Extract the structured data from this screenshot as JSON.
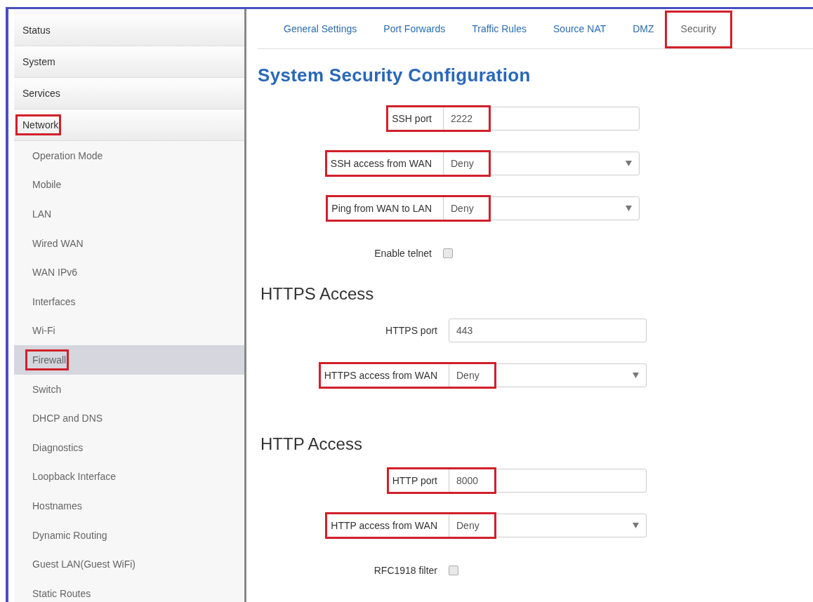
{
  "sidebar": {
    "items": [
      {
        "label": "Status",
        "kind": "group",
        "selected": false,
        "highlighted": false
      },
      {
        "label": "System",
        "kind": "group",
        "selected": false,
        "highlighted": false
      },
      {
        "label": "Services",
        "kind": "group",
        "selected": false,
        "highlighted": false
      },
      {
        "label": "Network",
        "kind": "group",
        "selected": false,
        "highlighted": true
      },
      {
        "label": "Operation Mode",
        "kind": "sub",
        "selected": false,
        "highlighted": false
      },
      {
        "label": "Mobile",
        "kind": "sub",
        "selected": false,
        "highlighted": false
      },
      {
        "label": "LAN",
        "kind": "sub",
        "selected": false,
        "highlighted": false
      },
      {
        "label": "Wired WAN",
        "kind": "sub",
        "selected": false,
        "highlighted": false
      },
      {
        "label": "WAN IPv6",
        "kind": "sub",
        "selected": false,
        "highlighted": false
      },
      {
        "label": "Interfaces",
        "kind": "sub",
        "selected": false,
        "highlighted": false
      },
      {
        "label": "Wi-Fi",
        "kind": "sub",
        "selected": false,
        "highlighted": false
      },
      {
        "label": "Firewall",
        "kind": "sub",
        "selected": true,
        "highlighted": true
      },
      {
        "label": "Switch",
        "kind": "sub",
        "selected": false,
        "highlighted": false
      },
      {
        "label": "DHCP and DNS",
        "kind": "sub",
        "selected": false,
        "highlighted": false
      },
      {
        "label": "Diagnostics",
        "kind": "sub",
        "selected": false,
        "highlighted": false
      },
      {
        "label": "Loopback Interface",
        "kind": "sub",
        "selected": false,
        "highlighted": false
      },
      {
        "label": "Hostnames",
        "kind": "sub",
        "selected": false,
        "highlighted": false
      },
      {
        "label": "Dynamic Routing",
        "kind": "sub",
        "selected": false,
        "highlighted": false
      },
      {
        "label": "Guest LAN(Guest WiFi)",
        "kind": "sub",
        "selected": false,
        "highlighted": false
      },
      {
        "label": "Static Routes",
        "kind": "sub",
        "selected": false,
        "highlighted": false
      }
    ]
  },
  "tabs": [
    {
      "label": "General Settings",
      "selected": false,
      "highlighted": false
    },
    {
      "label": "Port Forwards",
      "selected": false,
      "highlighted": false
    },
    {
      "label": "Traffic Rules",
      "selected": false,
      "highlighted": false
    },
    {
      "label": "Source NAT",
      "selected": false,
      "highlighted": false
    },
    {
      "label": "DMZ",
      "selected": false,
      "highlighted": false
    },
    {
      "label": "Security",
      "selected": true,
      "highlighted": true
    }
  ],
  "title": "System Security Configuration",
  "sections": [
    {
      "fields": [
        {
          "kind": "text",
          "label": "SSH port",
          "value": "2222",
          "highlighted": true
        },
        {
          "kind": "select",
          "label": "SSH access from WAN",
          "value": "Deny",
          "highlighted": true
        },
        {
          "kind": "select",
          "label": "Ping from WAN to LAN",
          "value": "Deny",
          "highlighted": true
        },
        {
          "kind": "checkbox",
          "label": "Enable telnet",
          "checked": false,
          "highlighted": false
        }
      ]
    },
    {
      "heading": "HTTPS Access",
      "fields": [
        {
          "kind": "text",
          "label": "HTTPS port",
          "value": "443",
          "highlighted": false
        },
        {
          "kind": "select",
          "label": "HTTPS access from WAN",
          "value": "Deny",
          "highlighted": true
        }
      ]
    },
    {
      "heading": "HTTP Access",
      "fields": [
        {
          "kind": "text",
          "label": "HTTP port",
          "value": "8000",
          "highlighted": true
        },
        {
          "kind": "select",
          "label": "HTTP access from WAN",
          "value": "Deny",
          "highlighted": true
        },
        {
          "kind": "checkbox",
          "label": "RFC1918 filter",
          "checked": false,
          "highlighted": false
        }
      ]
    }
  ]
}
